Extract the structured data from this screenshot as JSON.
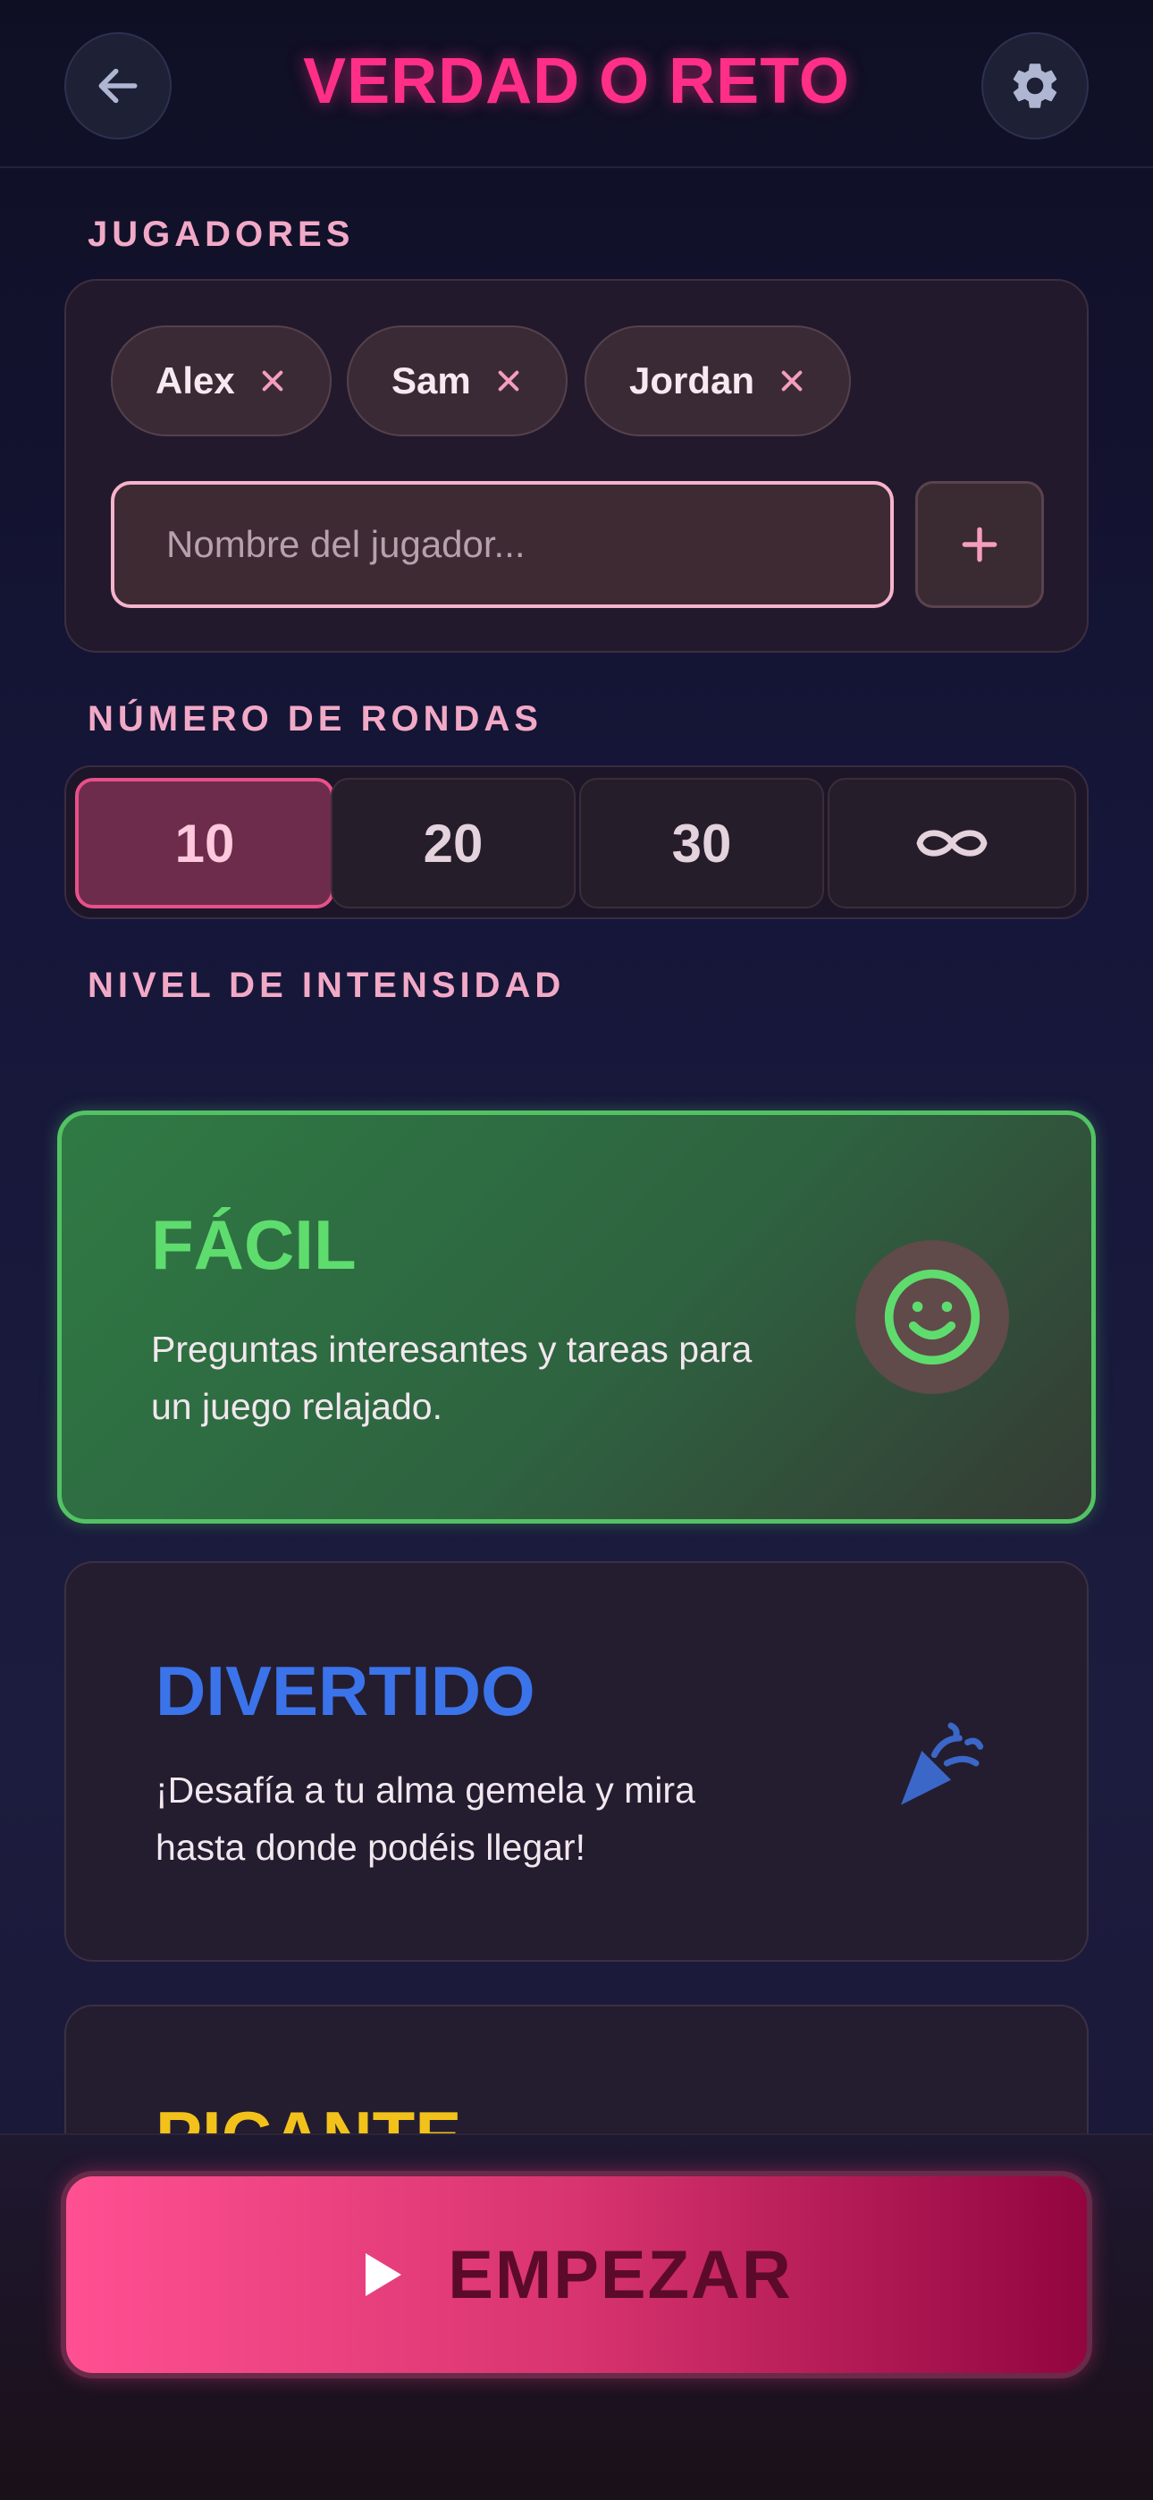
{
  "header": {
    "title": "VERDAD O RETO",
    "back_icon": "arrow-left-icon",
    "settings_icon": "gear-icon"
  },
  "players": {
    "section_label": "JUGADORES",
    "list": [
      {
        "name": "Alex"
      },
      {
        "name": "Sam"
      },
      {
        "name": "Jordan"
      }
    ],
    "input_placeholder": "Nombre del jugador...",
    "input_value": "",
    "add_icon": "plus-icon"
  },
  "rounds": {
    "section_label": "NÚMERO DE RONDAS",
    "options": [
      "10",
      "20",
      "30",
      "∞"
    ],
    "selected": "10"
  },
  "intensity": {
    "section_label": "NIVEL DE INTENSIDAD",
    "levels": [
      {
        "title": "FÁCIL",
        "description": "Preguntas interesantes y tareas para un juego relajado.",
        "icon": "smiley-icon",
        "color": "#5fdc6e",
        "selected": true
      },
      {
        "title": "DIVERTIDO",
        "description": "¡Desafía a tu alma gemela y mira hasta donde podéis llegar!",
        "icon": "party-popper-icon",
        "color": "#3b74ea",
        "selected": false
      },
      {
        "title": "PICANTE",
        "description": "",
        "icon": "",
        "color": "#f2c21b",
        "selected": false
      }
    ]
  },
  "footer": {
    "start_label": "EMPEZAR",
    "start_icon": "play-icon"
  },
  "colors": {
    "accent": "#ff2f88",
    "background": "#16163a"
  }
}
